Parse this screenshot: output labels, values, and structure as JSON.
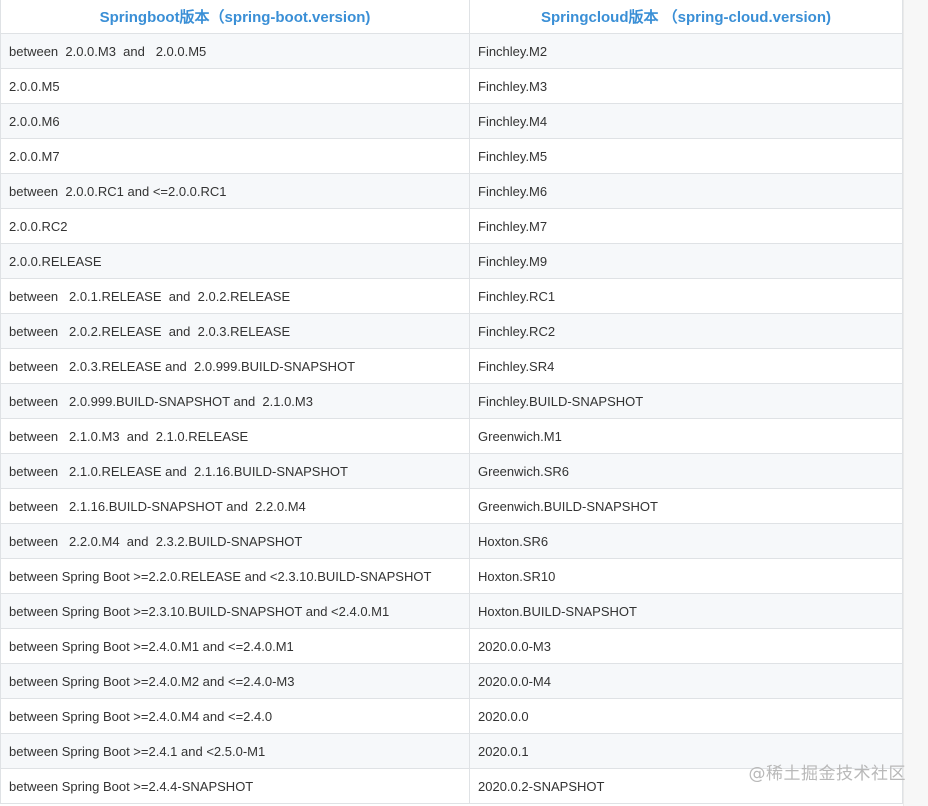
{
  "table": {
    "headers": [
      "Springboot版本（spring-boot.version)",
      "Springcloud版本 （spring-cloud.version)"
    ],
    "rows": [
      [
        "between  2.0.0.M3  and   2.0.0.M5",
        "Finchley.M2"
      ],
      [
        "2.0.0.M5",
        "Finchley.M3"
      ],
      [
        "2.0.0.M6",
        "Finchley.M4"
      ],
      [
        "2.0.0.M7",
        "Finchley.M5"
      ],
      [
        "between  2.0.0.RC1 and <=2.0.0.RC1",
        "Finchley.M6"
      ],
      [
        "2.0.0.RC2",
        "Finchley.M7"
      ],
      [
        "2.0.0.RELEASE",
        "Finchley.M9"
      ],
      [
        "between   2.0.1.RELEASE  and  2.0.2.RELEASE",
        "Finchley.RC1"
      ],
      [
        "between   2.0.2.RELEASE  and  2.0.3.RELEASE",
        "Finchley.RC2"
      ],
      [
        "between   2.0.3.RELEASE and  2.0.999.BUILD-SNAPSHOT",
        "Finchley.SR4"
      ],
      [
        "between   2.0.999.BUILD-SNAPSHOT and  2.1.0.M3",
        "Finchley.BUILD-SNAPSHOT"
      ],
      [
        "between   2.1.0.M3  and  2.1.0.RELEASE",
        "Greenwich.M1"
      ],
      [
        "between   2.1.0.RELEASE and  2.1.16.BUILD-SNAPSHOT",
        "Greenwich.SR6"
      ],
      [
        "between   2.1.16.BUILD-SNAPSHOT and  2.2.0.M4",
        "Greenwich.BUILD-SNAPSHOT"
      ],
      [
        "between   2.2.0.M4  and  2.3.2.BUILD-SNAPSHOT",
        "Hoxton.SR6"
      ],
      [
        "between Spring Boot >=2.2.0.RELEASE and <2.3.10.BUILD-SNAPSHOT",
        "Hoxton.SR10"
      ],
      [
        "between Spring Boot >=2.3.10.BUILD-SNAPSHOT and <2.4.0.M1",
        "Hoxton.BUILD-SNAPSHOT"
      ],
      [
        "between Spring Boot >=2.4.0.M1 and <=2.4.0.M1",
        "2020.0.0-M3"
      ],
      [
        "between Spring Boot >=2.4.0.M2 and <=2.4.0-M3",
        "2020.0.0-M4"
      ],
      [
        "between Spring Boot >=2.4.0.M4 and <=2.4.0",
        "2020.0.0"
      ],
      [
        "between Spring Boot >=2.4.1 and <2.5.0-M1",
        "2020.0.1"
      ],
      [
        "between Spring Boot >=2.4.4-SNAPSHOT",
        "2020.0.2-SNAPSHOT"
      ]
    ]
  },
  "watermark": "@稀土掘金技术社区",
  "colors": {
    "header_text": "#3a8fd6",
    "row_stripe": "#f6f8fa",
    "border": "#dfe2e5",
    "body_text": "#333333"
  }
}
